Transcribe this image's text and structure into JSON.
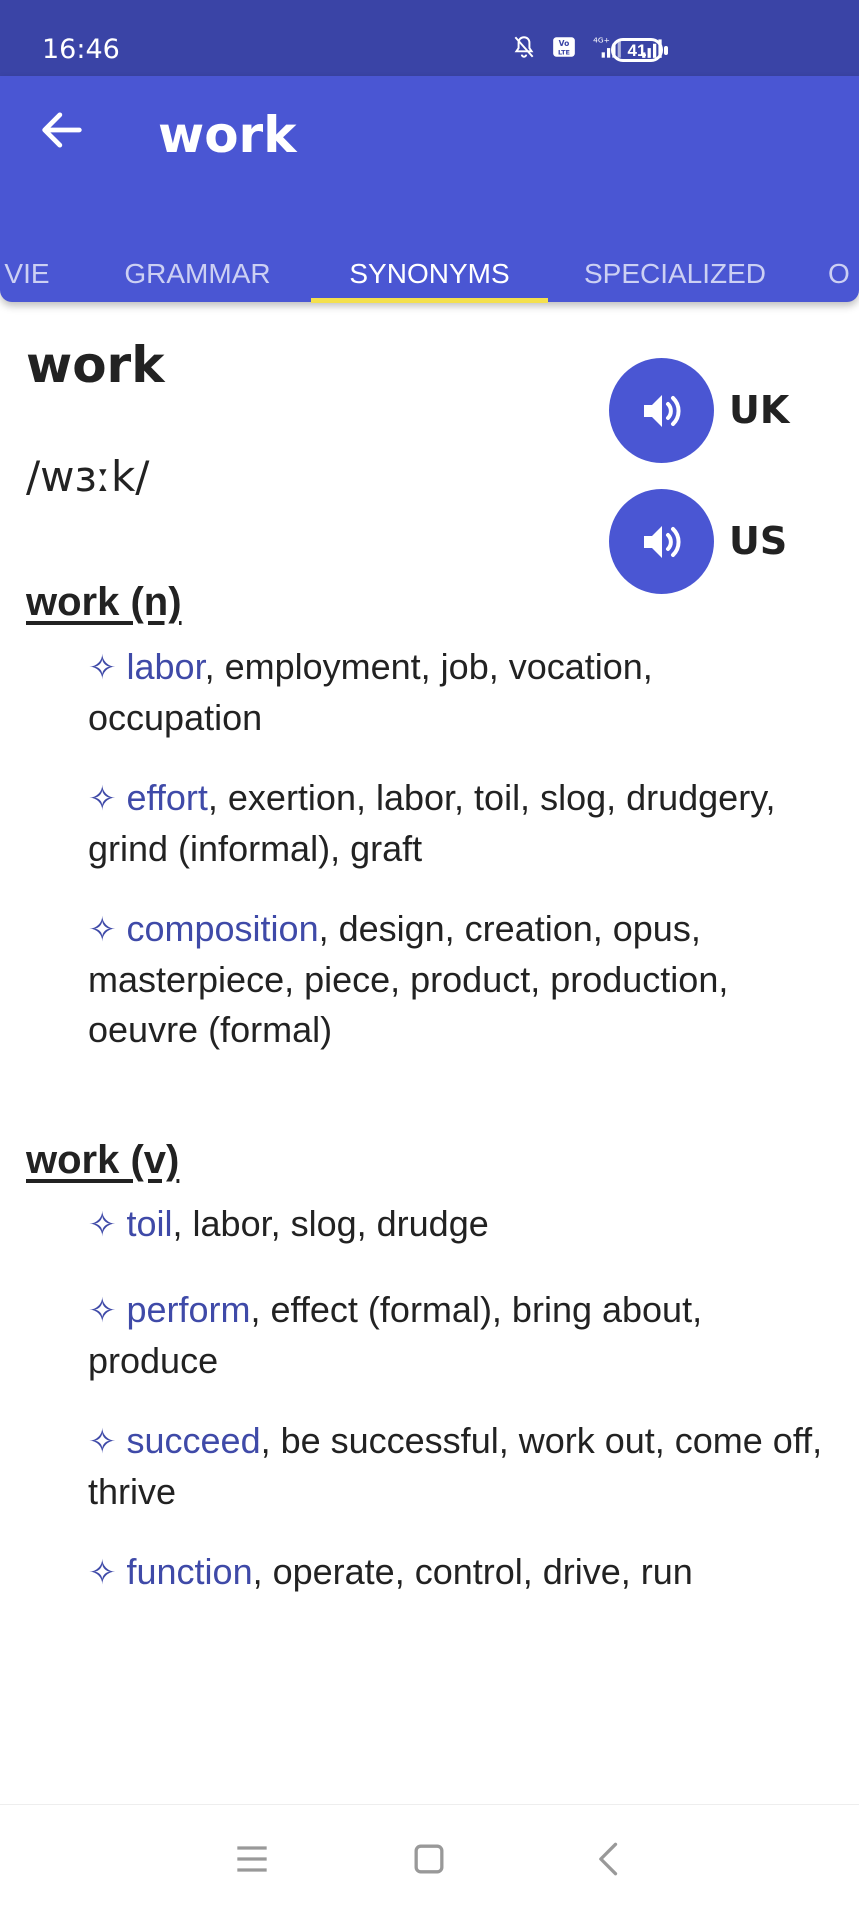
{
  "status_bar": {
    "time": "16:46",
    "battery": "41",
    "icons": [
      "mute-bell-icon",
      "volte-icon",
      "signal-4g-icon",
      "signal-icon",
      "battery-icon"
    ]
  },
  "app_bar": {
    "title": "work",
    "back_icon": "back-arrow-icon"
  },
  "tabs": [
    {
      "label": "VIE",
      "active": false
    },
    {
      "label": "GRAMMAR",
      "active": false
    },
    {
      "label": "SYNONYMS",
      "active": true
    },
    {
      "label": "SPECIALIZED",
      "active": false
    },
    {
      "label": "O",
      "active": false
    }
  ],
  "entry": {
    "word": "work",
    "phonetic": "/wɜːk/",
    "speakers": [
      {
        "label": "UK",
        "icon": "speaker-icon"
      },
      {
        "label": "US",
        "icon": "speaker-icon"
      }
    ]
  },
  "sections": [
    {
      "heading": "work (n)",
      "groups": [
        {
          "head": "labor",
          "rest": ", employment, job, vocation, occupation"
        },
        {
          "head": "effort",
          "rest": ", exertion, labor, toil, slog, drudgery, grind (informal), graft"
        },
        {
          "head": "composition",
          "rest": ", design, creation, opus, masterpiece, piece, product, production, oeuvre (formal)"
        }
      ]
    },
    {
      "heading": "work (v)",
      "groups": [
        {
          "head": "toil",
          "rest": ", labor, slog, drudge"
        },
        {
          "head": "perform",
          "rest": ", effect (formal), bring about, produce"
        },
        {
          "head": "succeed",
          "rest": ", be successful, work out, come off, thrive"
        },
        {
          "head": "function",
          "rest": ", operate, control, drive, run"
        }
      ]
    }
  ],
  "symbol": "✧",
  "colors": {
    "status_bar": "#3a44a6",
    "app_bar": "#4a56d3",
    "tab_indicator": "#f4e04d",
    "link": "#3f4aa8"
  },
  "nav_bar": [
    "menu-icon",
    "home-square-icon",
    "back-chevron-icon"
  ]
}
